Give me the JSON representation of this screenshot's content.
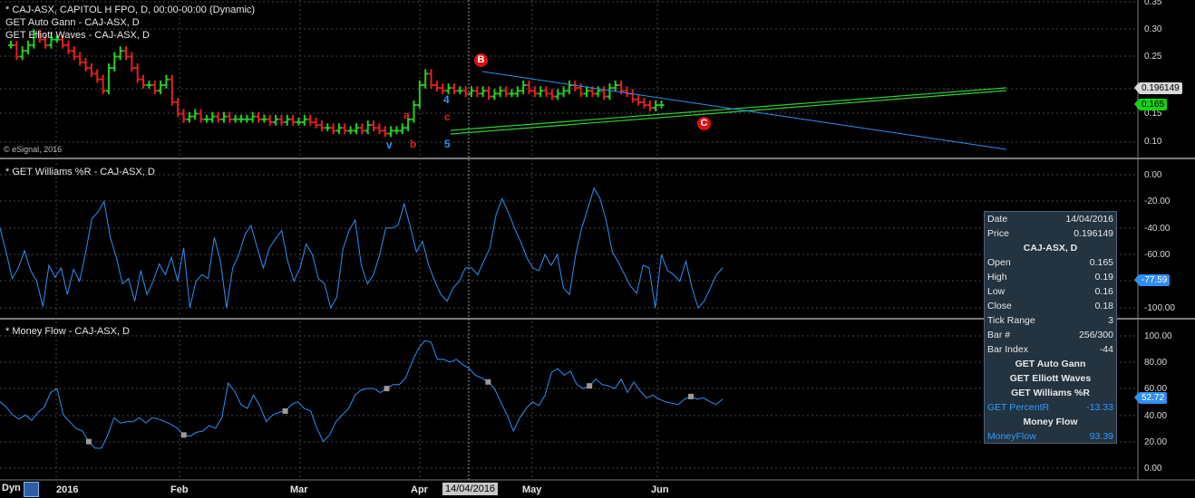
{
  "header": {
    "line1": "* CAJ-ASX, CAPITOL H FPO, D, 00:00-00:00 (Dynamic)",
    "line2": "GET Auto Gann - CAJ-ASX, D",
    "line3": "GET Elliott Waves - CAJ-ASX, D",
    "credit": "© eSignal, 2016"
  },
  "panes": {
    "price_title": "",
    "williams_title": "* GET Williams %R - CAJ-ASX, D",
    "mf_title": "* Money Flow - CAJ-ASX, D"
  },
  "axes": {
    "price_ticks": [
      "0.35",
      "0.30",
      "0.25",
      "0.15",
      "0.10"
    ],
    "williams_ticks": [
      "0.00",
      "-20.00",
      "-40.00",
      "-60.00",
      "-100.00"
    ],
    "mf_ticks": [
      "100.00",
      "80.00",
      "60.00",
      "40.00",
      "20.00",
      "0.00"
    ],
    "tags": {
      "price_cursor": "0.196149",
      "price_last": "0.165",
      "williams_last": "-77.59",
      "mf_last": "52.72"
    }
  },
  "x_axis": {
    "labels": [
      "2016",
      "Feb",
      "Mar",
      "Apr",
      "May",
      "Jun"
    ],
    "cursor_date": "14/04/2016",
    "mode": "Dyn"
  },
  "elliott": {
    "labels": [
      "v",
      "a",
      "b",
      "c",
      "4",
      "5"
    ],
    "circles": [
      "B",
      "C"
    ]
  },
  "data_window": {
    "date_label": "Date",
    "date": "14/04/2016",
    "price_label": "Price",
    "price": "0.196149",
    "symbol": "CAJ-ASX, D",
    "open_label": "Open",
    "open": "0.165",
    "high_label": "High",
    "high": "0.19",
    "low_label": "Low",
    "low": "0.16",
    "close_label": "Close",
    "close": "0.18",
    "tick_label": "Tick Range",
    "tick": "3",
    "bar_label": "Bar #",
    "bar": "256/300",
    "index_label": "Bar Index",
    "index": "-44",
    "study1": "GET Auto Gann",
    "study2": "GET Elliott Waves",
    "study3": "GET Williams %R",
    "pr_label": "GET PercentR",
    "pr": "-13.33",
    "study4": "Money Flow",
    "mf_label": "MoneyFlow",
    "mf": "93.39"
  },
  "colors": {
    "up": "#21d021",
    "down": "#e22020",
    "line": "#2f8ff2",
    "gann": "#2fd02f",
    "grid": "#444444"
  },
  "chart_data": [
    {
      "type": "line",
      "title": "GET Williams %R - CAJ-ASX, D",
      "ylim": [
        -100,
        0
      ],
      "values": [
        -40,
        -58,
        -78,
        -70,
        -57,
        -72,
        -80,
        -99,
        -68,
        -77,
        -70,
        -90,
        -71,
        -80,
        -58,
        -33,
        -28,
        -20,
        -47,
        -62,
        -82,
        -78,
        -95,
        -72,
        -90,
        -80,
        -67,
        -75,
        -62,
        -80,
        -55,
        -100,
        -80,
        -75,
        -78,
        -47,
        -65,
        -100,
        -70,
        -60,
        -45,
        -38,
        -55,
        -70,
        -55,
        -48,
        -42,
        -65,
        -80,
        -70,
        -52,
        -60,
        -78,
        -82,
        -100,
        -92,
        -56,
        -42,
        -34,
        -68,
        -82,
        -75,
        -60,
        -40,
        -40,
        -38,
        -22,
        -39,
        -58,
        -50,
        -68,
        -80,
        -90,
        -95,
        -85,
        -80,
        -70,
        -70,
        -75,
        -65,
        -55,
        -30,
        -18,
        -28,
        -40,
        -50,
        -62,
        -70,
        -72,
        -60,
        -68,
        -60,
        -85,
        -90,
        -60,
        -40,
        -25,
        -10,
        -18,
        -35,
        -58,
        -66,
        -75,
        -84,
        -89,
        -68,
        -70,
        -100,
        -60,
        -72,
        -75,
        -80,
        -65,
        -85,
        -100,
        -95,
        -85,
        -75,
        -70
      ]
    },
    {
      "type": "line",
      "title": "Money Flow - CAJ-ASX, D",
      "ylim": [
        0,
        100
      ],
      "values": [
        50,
        46,
        40,
        37,
        40,
        36,
        42,
        46,
        57,
        60,
        40,
        35,
        30,
        28,
        20,
        15,
        15,
        25,
        38,
        34,
        35,
        35,
        38,
        34,
        38,
        37,
        35,
        33,
        30,
        25,
        24,
        27,
        28,
        32,
        30,
        38,
        64,
        58,
        48,
        45,
        55,
        47,
        35,
        40,
        42,
        43,
        48,
        50,
        45,
        43,
        30,
        20,
        25,
        35,
        40,
        45,
        55,
        59,
        60,
        60,
        57,
        60,
        63,
        63,
        68,
        80,
        90,
        96,
        95,
        82,
        82,
        80,
        82,
        78,
        75,
        70,
        68,
        65,
        60,
        50,
        40,
        28,
        38,
        45,
        50,
        47,
        55,
        72,
        75,
        70,
        73,
        63,
        60,
        62,
        67,
        63,
        62,
        60,
        67,
        57,
        65,
        58,
        53,
        55,
        52,
        50,
        49,
        48,
        52,
        54,
        52,
        53,
        50,
        48,
        52
      ]
    }
  ]
}
